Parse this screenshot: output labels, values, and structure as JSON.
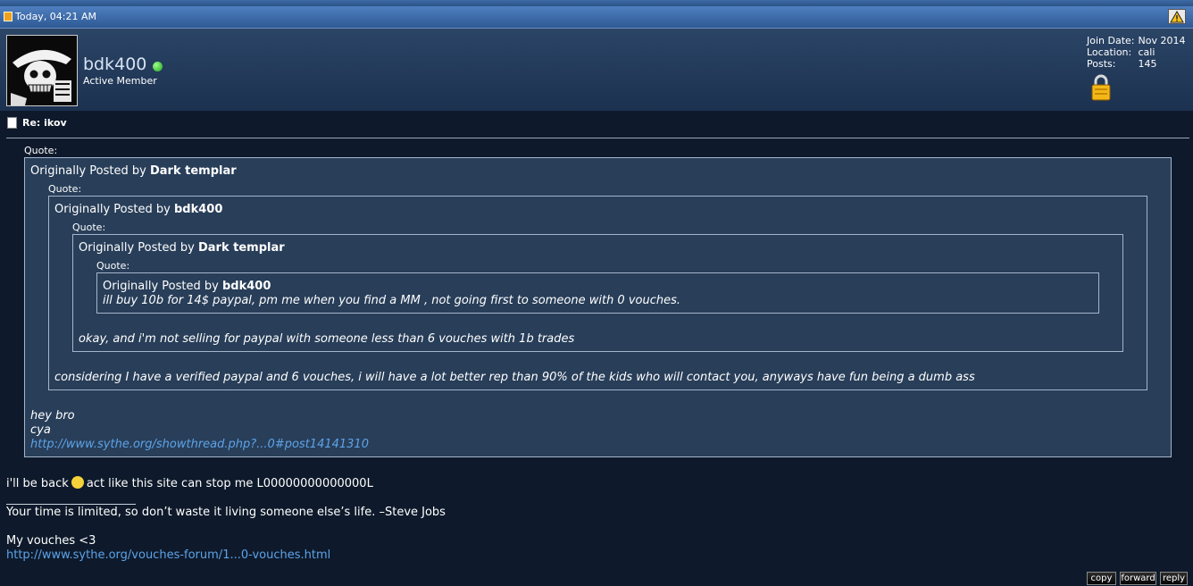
{
  "header": {
    "timestamp": "Today, 04:21 AM",
    "report_icon": "warning-icon"
  },
  "user": {
    "name": "bdk400",
    "title": "Active Member",
    "status": "online",
    "info": [
      {
        "label": "Join Date:",
        "value": "Nov 2014"
      },
      {
        "label": "Location:",
        "value": "cali"
      },
      {
        "label": "Posts:",
        "value": "145"
      }
    ]
  },
  "post": {
    "title": "Re: ikov",
    "quote_label": "Quote:",
    "posted_by_prefix": "Originally Posted by",
    "quotes": [
      {
        "author": "Dark templar",
        "lines": [
          "hey bro",
          "cya"
        ],
        "link": "http://www.sythe.org/showthread.php?...0#post14141310"
      },
      {
        "author": "bdk400",
        "text": "considering I have a verified paypal and 6 vouches, i will have a lot better rep than 90% of the kids who will contact you, anyways have fun being a dumb ass"
      },
      {
        "author": "Dark templar",
        "text": "okay, and i'm not selling for paypal with someone less than 6 vouches with 1b trades"
      },
      {
        "author": "bdk400",
        "text": "ill buy 10b for 14$ paypal, pm me when you find a MM , not going first to someone with 0 vouches."
      }
    ],
    "body_before_smiley": "i'll be back",
    "body_after_smiley": "act like this site can stop me L00000000000000L",
    "signature": {
      "quote": "Your time is limited, so don’t waste it living someone else’s life. –Steve Jobs",
      "vouches_label": "My vouches <3",
      "vouches_link": "http://www.sythe.org/vouches-forum/1...0-vouches.html"
    }
  },
  "buttons": {
    "copy": "copy",
    "forward": "forward",
    "reply": "reply"
  },
  "colors": {
    "link": "#5da3e8",
    "background": "#0e1a2b",
    "quote_bg": "#283e59",
    "header": "#3d6aa5"
  }
}
